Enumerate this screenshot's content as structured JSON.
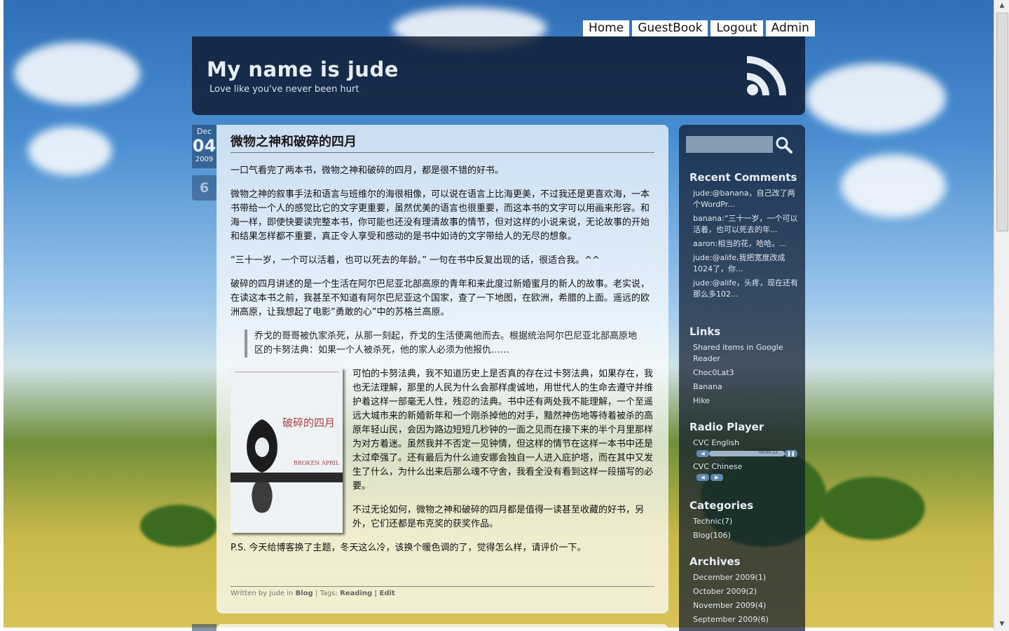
{
  "nav": [
    "Home",
    "GuestBook",
    "Logout",
    "Admin"
  ],
  "site": {
    "title": "My name is jude",
    "tagline": "Love like you've never been hurt"
  },
  "post": {
    "date": {
      "month": "Dec",
      "day": "04",
      "year": "2009"
    },
    "comment_count": "6",
    "title": "微物之神和破碎的四月",
    "p1": "一口气看完了两本书，微物之神和破碎的四月，都是很不错的好书。",
    "p2": "微物之神的叙事手法和语言与班维尔的海很相像，可以说在语言上比海更美，不过我还是更喜欢海，一本书带给一个人的感觉比它的文字更重要，虽然优美的语言也很重要，而这本书的文字可以用画来形容。和海一样，即使快要读完整本书，你可能也还没有理清故事的情节，但对这样的小说来说，无论故事的开始和结果怎样都不重要，真正令人享受和感动的是书中如诗的文字带给人的无尽的想象。",
    "p3": "“三十一岁，一个可以活着，也可以死去的年龄。” 一句在书中反复出现的话，很适合我。^^",
    "p4": "破碎的四月讲述的是一个生活在阿尔巴尼亚北部高原的青年和来此度过新婚蜜月的新人的故事。老实说，在读这本书之前，我甚至不知道有阿尔巴尼亚这个国家，查了一下地图，在欧洲，希腊的上面。遥远的欧洲高原，让我想起了电影”勇敢的心”中的苏格兰高原。",
    "quote": "乔戈的哥哥被仇家杀死，从那一刻起，乔戈的生活便离他而去。根据统治阿尔巴尼亚北部高原地区的卡努法典：如果一个人被杀死，他的家人必须为他报仇……",
    "book": {
      "title_cn": "破碎的四月",
      "title_en": "BROKEN APRIL"
    },
    "p5": "可怕的卡努法典，我不知道历史上是否真的存在过卡努法典，如果存在，我也无法理解，那里的人民为什么会那样虔诚地，用世代人的生命去遵守并维护着这样一部毫无人性，残忍的法典。书中还有两处我不能理解，一个至遥远大城市来的新婚新年和一个刚杀掉他的对手，黯然神伤地等待着被杀的高原年轻山民，会因为路边短短几秒钟的一面之见而在接下来的半个月里那样为对方着迷。虽然我并不否定一见钟情，但这样的情节在这样一本书中还是太过牵强了。还有最后为什么迪安娜会独自一人进入庇护塔，而在其中又发生了什么，为什么出来后那么魂不守舍，我看全没有看到这样一段描写的必要。",
    "p6": "不过无论如何，微物之神和破碎的四月都是值得一读甚至收藏的好书，另外，它们还都是布克奖的获奖作品。",
    "p7": "P.S. 今天给博客换了主题，冬天这么冷，该换个暖色调的了，觉得怎么样，请评价一下。",
    "footer": {
      "written_by": "Written by Jude in",
      "category": "Blog",
      "tags_label": "| Tags:",
      "tag": "Reading",
      "edit": "| Edit"
    }
  },
  "sidebar": {
    "recent_comments": {
      "title": "Recent Comments",
      "items": [
        "jude:@banana，自己改了两个WordPr...",
        "banana:“三十一岁，一个可以活着，也可以死去的年...",
        "aaron:相当的花，哈哈。...",
        "jude:@alife,我把宽度改成1024了，你...",
        "jude:@alife，头疼，现在还有那么多102..."
      ]
    },
    "links": {
      "title": "Links",
      "items": [
        "Shared items in Google Reader",
        "Choc0Lat3",
        "Banana",
        "Hike"
      ]
    },
    "radio": {
      "title": "Radio Player",
      "items": [
        "CVC English",
        "CVC Chinese"
      ],
      "time": "00:00:13"
    },
    "categories": {
      "title": "Categories",
      "items": [
        "Technic(7)",
        "Blog(106)"
      ]
    },
    "archives": {
      "title": "Archives",
      "items": [
        "December 2009(1)",
        "October 2009(2)",
        "November 2009(4)",
        "September 2009(6)"
      ]
    }
  }
}
